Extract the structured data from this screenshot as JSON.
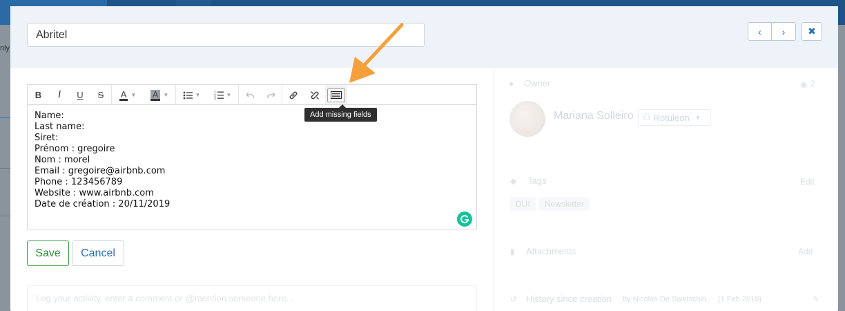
{
  "background": {
    "left_text": "nly"
  },
  "header": {
    "title_value": "Abritel",
    "prev_label": "‹",
    "next_label": "›",
    "close_label": "✖"
  },
  "toolbar": {
    "bold": "B",
    "italic": "I",
    "underline": "U",
    "strike": "S",
    "font_color": "A",
    "highlight": "A",
    "tooltip": "Add missing fields"
  },
  "editor": {
    "lines": [
      "Name:",
      "Last name:",
      "Siret:",
      "Prénom : gregoire",
      "Nom : morel",
      "Email : gregoire@airbnb.com",
      "Phone : 123456789",
      "Website : www.airbnb.com",
      "Date de création : 20/11/2019"
    ]
  },
  "actions": {
    "save_label": "Save",
    "cancel_label": "Cancel"
  },
  "activity": {
    "placeholder": "Log your activity, enter a comment or @mention someone here..."
  },
  "sidebar": {
    "owner_label": "Owner",
    "followers_count": "2",
    "owner_name": "Mariana Solleiro",
    "team_name": "Rotuleon",
    "tags_label": "Tags",
    "tags_edit": "Edit",
    "tags": [
      "DUI",
      "Newsletter"
    ],
    "attachments_label": "Attachments",
    "attachments_add": "Add",
    "history_label": "History since creation",
    "history_by": "by Nicolas De Swetschin",
    "history_ago": "(1 Feb 2019)"
  },
  "colors": {
    "accent_blue": "#2a6ebb",
    "save_green": "#2e8b33",
    "arrow_orange": "#f5a03a",
    "header_bg": "#eef3f9"
  }
}
